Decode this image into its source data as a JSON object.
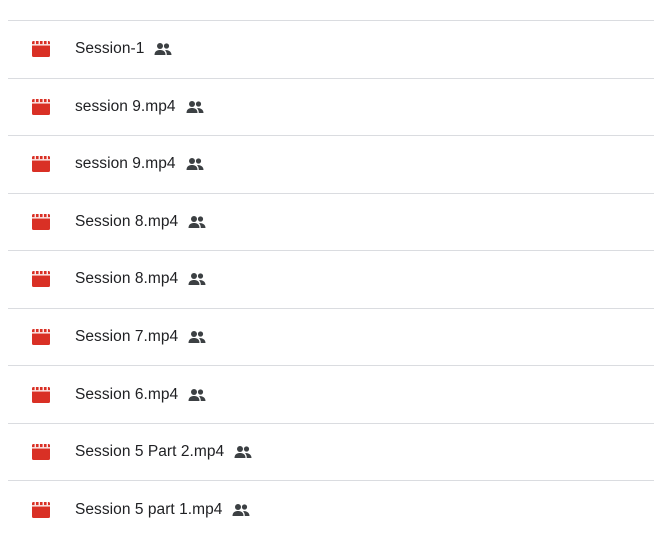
{
  "files": [
    {
      "name": "Session-1",
      "icon": "video-file-icon",
      "shared": true
    },
    {
      "name": "session 9.mp4",
      "icon": "video-file-icon",
      "shared": true
    },
    {
      "name": "session 9.mp4",
      "icon": "video-file-icon",
      "shared": true
    },
    {
      "name": "Session 8.mp4",
      "icon": "video-file-icon",
      "shared": true
    },
    {
      "name": "Session 8.mp4",
      "icon": "video-file-icon",
      "shared": true
    },
    {
      "name": "Session 7.mp4",
      "icon": "video-file-icon",
      "shared": true
    },
    {
      "name": "Session 6.mp4",
      "icon": "video-file-icon",
      "shared": true
    },
    {
      "name": "Session 5 Part 2.mp4",
      "icon": "video-file-icon",
      "shared": true
    },
    {
      "name": "Session 5 part 1.mp4",
      "icon": "video-file-icon",
      "shared": true
    }
  ],
  "colors": {
    "video_icon": "#d93025",
    "shared_icon": "#3c4043",
    "text": "#202124",
    "divider": "#dadce0"
  }
}
